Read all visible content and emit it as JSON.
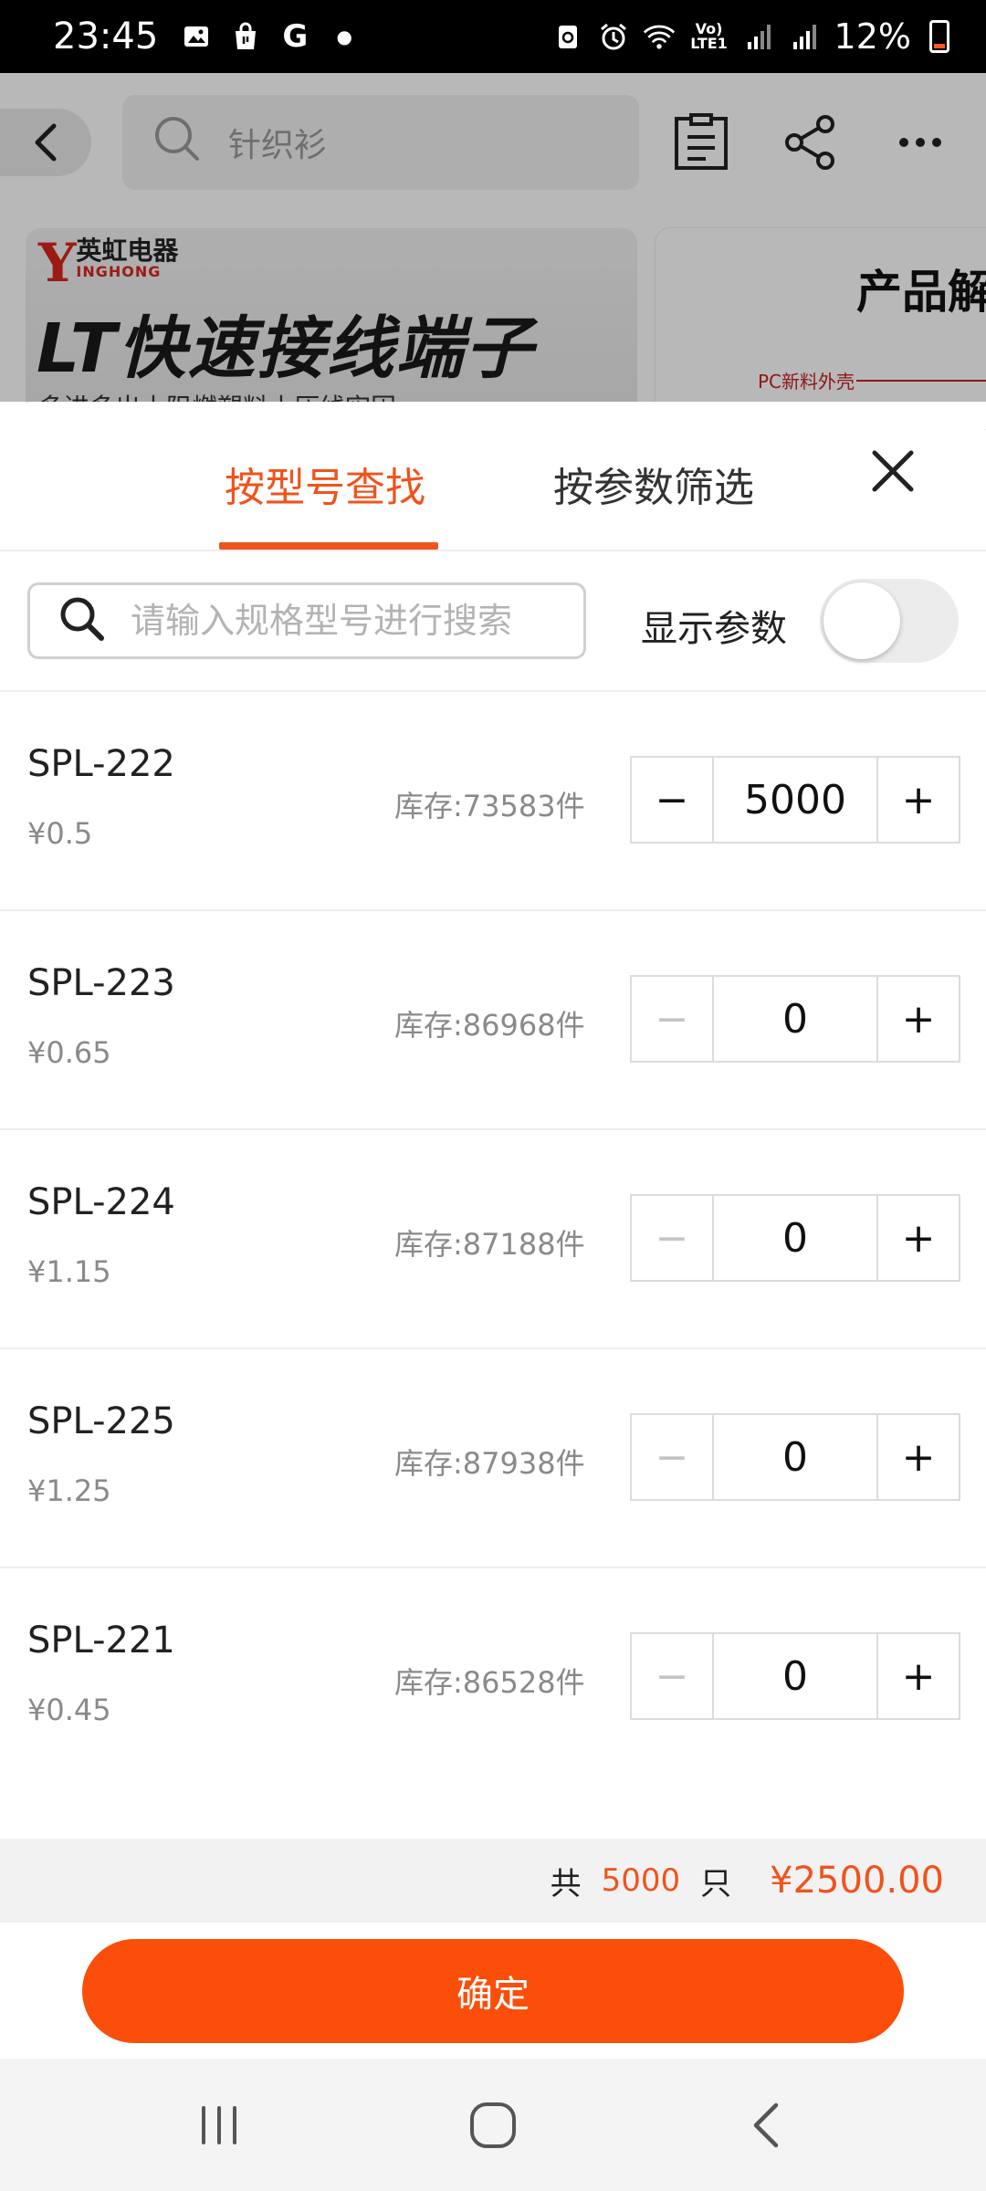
{
  "status_bar": {
    "time": "23:45",
    "battery_percent": "12%",
    "volte_label": "Vo) LTE1"
  },
  "background": {
    "search_placeholder": "针织衫",
    "banner_brand": "英虹电器",
    "banner_brand_en": "INGHONG",
    "banner_headline": "LT快速接线端子",
    "banner_sub": "多进多出丨阻燃塑料丨压线牢固",
    "banner_right_title": "产品解",
    "banner_right_note": "PC新料外壳"
  },
  "sheet": {
    "tabs": [
      {
        "label": "按型号查找",
        "active": true
      },
      {
        "label": "按参数筛选",
        "active": false
      }
    ],
    "search_placeholder": "请输入规格型号进行搜索",
    "search_value": "",
    "show_params_label": "显示参数",
    "show_params_on": false,
    "items": [
      {
        "model": "SPL-222",
        "price": "¥0.5",
        "stock": "库存:73583件",
        "quantity": "5000",
        "minus": "−",
        "plus": "+"
      },
      {
        "model": "SPL-223",
        "price": "¥0.65",
        "stock": "库存:86968件",
        "quantity": "0",
        "minus": "−",
        "plus": "+"
      },
      {
        "model": "SPL-224",
        "price": "¥1.15",
        "stock": "库存:87188件",
        "quantity": "0",
        "minus": "−",
        "plus": "+"
      },
      {
        "model": "SPL-225",
        "price": "¥1.25",
        "stock": "库存:87938件",
        "quantity": "0",
        "minus": "−",
        "plus": "+"
      },
      {
        "model": "SPL-221",
        "price": "¥0.45",
        "stock": "库存:86528件",
        "quantity": "0",
        "minus": "−",
        "plus": "+"
      }
    ],
    "summary": {
      "prefix": "共",
      "count": "5000",
      "unit": "只",
      "total": "¥2500.00"
    },
    "confirm_label": "确定"
  },
  "colors": {
    "accent": "#f0531c",
    "confirm_button": "#fb4e0a",
    "disabled": "#c4c4c4"
  }
}
